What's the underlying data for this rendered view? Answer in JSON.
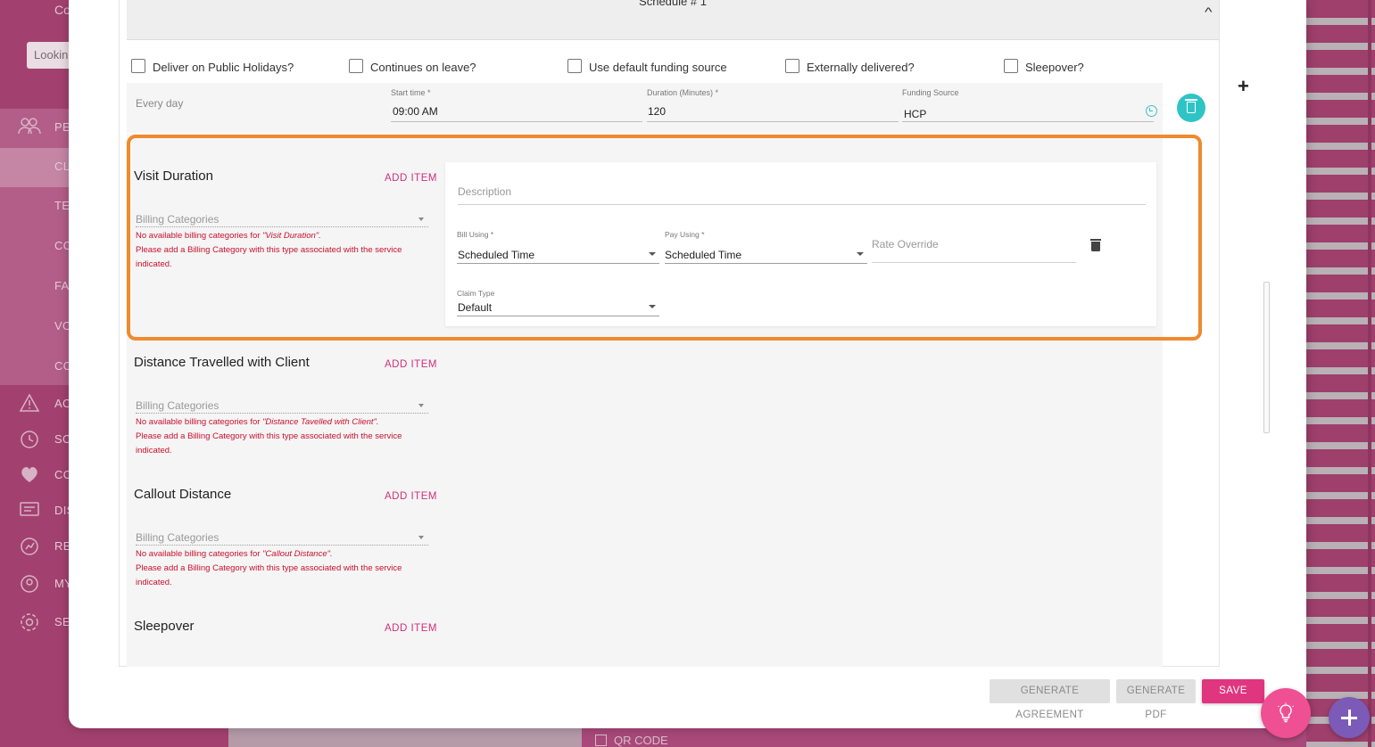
{
  "background": {
    "sidebar_top_text": "Co",
    "search_placeholder": "Lookin",
    "nav": [
      {
        "icon": "people-icon",
        "label": "PE"
      },
      {
        "icon": "",
        "label": "CL"
      },
      {
        "icon": "",
        "label": "TE"
      },
      {
        "icon": "",
        "label": "CO"
      },
      {
        "icon": "",
        "label": "FA"
      },
      {
        "icon": "",
        "label": "VO"
      },
      {
        "icon": "",
        "label": "CO"
      },
      {
        "icon": "warning-icon",
        "label": "AC"
      },
      {
        "icon": "schedule-icon",
        "label": "SC"
      },
      {
        "icon": "heart-icon",
        "label": "CO"
      },
      {
        "icon": "message-icon",
        "label": "DIS"
      },
      {
        "icon": "reports-icon",
        "label": "RE"
      },
      {
        "icon": "account-icon",
        "label": "MY"
      },
      {
        "icon": "settings-icon",
        "label": "SE"
      }
    ],
    "qr_code_label": "QR CODE"
  },
  "schedule": {
    "title": "Schedule # 1",
    "checkboxes": [
      {
        "label": "Deliver on Public Holidays?",
        "checked": false
      },
      {
        "label": "Continues on leave?",
        "checked": false
      },
      {
        "label": "Use default funding source",
        "checked": false
      },
      {
        "label": "Externally delivered?",
        "checked": false
      },
      {
        "label": "Sleepover?",
        "checked": false
      }
    ],
    "frequency": "Every day",
    "start_time": {
      "label": "Start time *",
      "value": "09:00 AM"
    },
    "duration": {
      "label": "Duration (Minutes) *",
      "value": "120"
    },
    "funding_source": {
      "label": "Funding Source",
      "value": "HCP"
    }
  },
  "sections": [
    {
      "title": "Visit Duration",
      "add_label": "ADD ITEM",
      "billing_placeholder": "Billing Categories",
      "error_prefix": "No available billing categories for ",
      "error_name": "\"Visit Duration\".",
      "error_line2": "Please add a Billing Category with this type associated with the service indicated."
    },
    {
      "title": "Distance Travelled with Client",
      "add_label": "ADD ITEM",
      "billing_placeholder": "Billing Categories",
      "error_prefix": "No available billing categories for ",
      "error_name": "\"Distance Tavelled with Client\".",
      "error_line2": "Please add a Billing Category with this type associated with the service indicated."
    },
    {
      "title": "Callout Distance",
      "add_label": "ADD ITEM",
      "billing_placeholder": "Billing Categories",
      "error_prefix": "No available billing categories for ",
      "error_name": "\"Callout Distance\".",
      "error_line2": "Please add a Billing Category with this type associated with the service indicated."
    },
    {
      "title": "Sleepover",
      "add_label": "ADD ITEM"
    }
  ],
  "item": {
    "description_placeholder": "Description",
    "bill_using": {
      "label": "Bill Using *",
      "value": "Scheduled Time"
    },
    "pay_using": {
      "label": "Pay Using *",
      "value": "Scheduled Time"
    },
    "rate_override_placeholder": "Rate Override",
    "claim_type": {
      "label": "Claim Type",
      "value": "Default"
    }
  },
  "footer": {
    "generate_agreement": "GENERATE AGREEMENT",
    "generate_pdf": "GENERATE PDF",
    "save": "SAVE"
  },
  "colors": {
    "accent_pink": "#e0357f",
    "teal": "#2ec4c6",
    "highlight_orange": "#ef8a2f",
    "error_red": "#c8102e"
  }
}
